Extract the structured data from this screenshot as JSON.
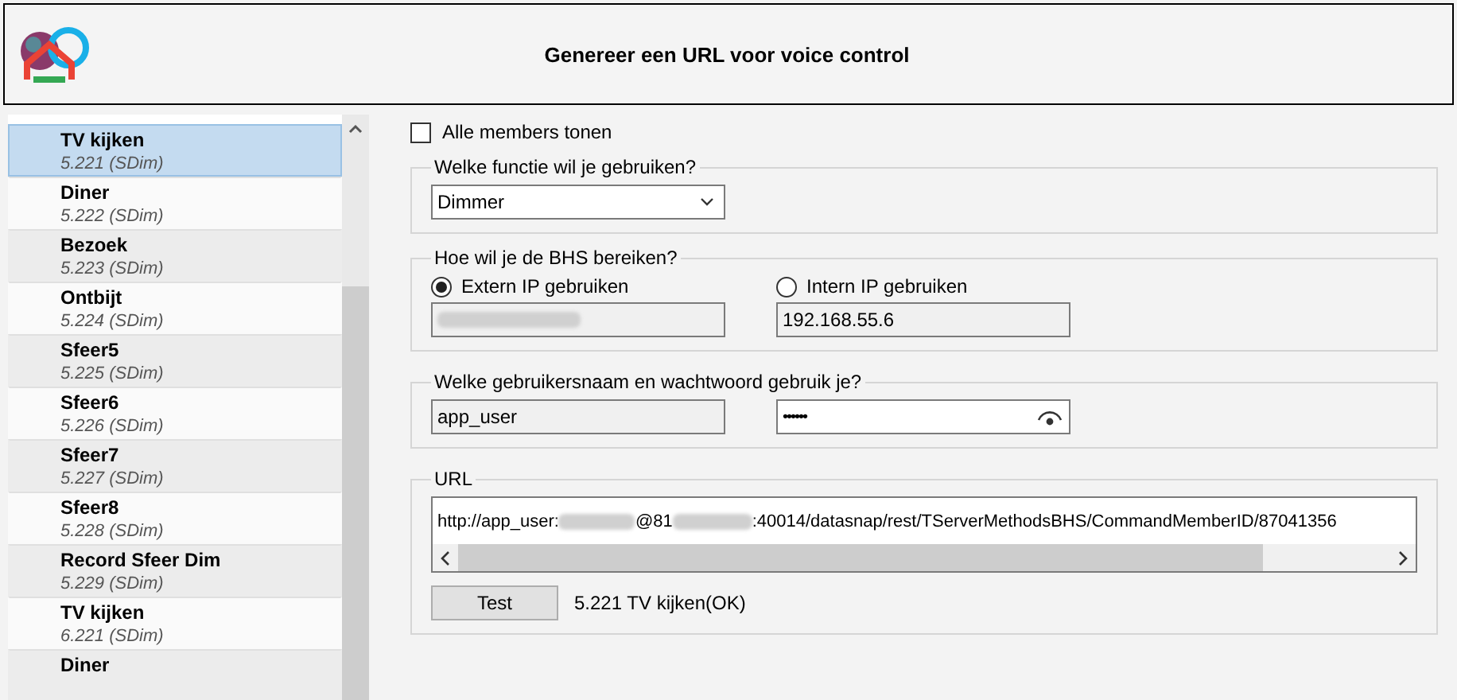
{
  "window": {
    "title": "Genereer een URL voor voice control"
  },
  "members": [
    {
      "name": "TV kijken",
      "id": "5.221 (SDim)",
      "selected": true
    },
    {
      "name": "Diner",
      "id": "5.222 (SDim)",
      "selected": false
    },
    {
      "name": "Bezoek",
      "id": "5.223 (SDim)",
      "selected": false
    },
    {
      "name": "Ontbijt",
      "id": "5.224 (SDim)",
      "selected": false
    },
    {
      "name": "Sfeer5",
      "id": "5.225 (SDim)",
      "selected": false
    },
    {
      "name": "Sfeer6",
      "id": "5.226 (SDim)",
      "selected": false
    },
    {
      "name": "Sfeer7",
      "id": "5.227 (SDim)",
      "selected": false
    },
    {
      "name": "Sfeer8",
      "id": "5.228 (SDim)",
      "selected": false
    },
    {
      "name": "Record Sfeer Dim",
      "id": "5.229 (SDim)",
      "selected": false
    },
    {
      "name": "TV kijken",
      "id": "6.221 (SDim)",
      "selected": false
    },
    {
      "name": "Diner",
      "selected": false
    }
  ],
  "show_all": {
    "label": "Alle members tonen",
    "checked": false
  },
  "function_group": {
    "legend": "Welke functie wil je gebruiken?",
    "value": "Dimmer"
  },
  "ip_group": {
    "legend": "Hoe wil je de BHS bereiken?",
    "options": [
      {
        "label": "Extern IP gebruiken",
        "selected": true,
        "blurred": true
      },
      {
        "label": "Intern IP gebruiken",
        "selected": false,
        "value": "192.168.55.6"
      }
    ]
  },
  "login_group": {
    "legend": "Welke gebruikersnaam en wachtwoord gebruik je?",
    "username": "app_user",
    "password": "••••••"
  },
  "url_group": {
    "legend": "URL",
    "url_parts": [
      "http://app_user:",
      "@81",
      ":40014/datasnap/rest/TServerMethodsBHS/CommandMemberID/87041356"
    ],
    "test_button": "Test",
    "result": "5.221 TV kijken(OK)"
  }
}
